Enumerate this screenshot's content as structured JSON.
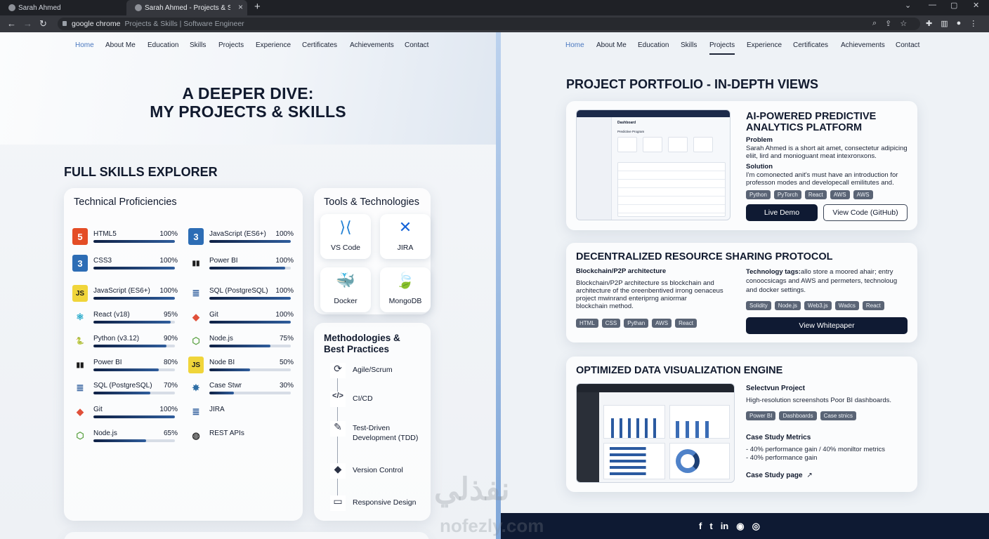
{
  "browser": {
    "tabs": [
      {
        "title": "Sarah Ahmed"
      },
      {
        "title": "Sarah Ahmed - Projects & Skills"
      }
    ],
    "new_tab": "+",
    "host": "google chrome",
    "path": "Projects & Skills | Software Engineer"
  },
  "left_nav": [
    "Home",
    "About Me",
    "Education",
    "Skills",
    "Projects",
    "Experience",
    "Certificates",
    "Achievements",
    "Contact"
  ],
  "right_nav": [
    "Home",
    "About Me",
    "Education",
    "Skills",
    "Projects",
    "Experience",
    "Certificates",
    "Achievements",
    "Contact"
  ],
  "hero": {
    "line1": "A DEEPER DIVE:",
    "line2": "MY PROJECTS & SKILLS"
  },
  "skills_section": "FULL SKILLS EXPLORER",
  "technical": {
    "title": "Technical Proficiencies",
    "left_col": [
      {
        "name": "HTML5",
        "pct": "100%",
        "level": 1.0,
        "icon": "html5-icon"
      },
      {
        "name": "CSS3",
        "pct": "100%",
        "level": 1.0,
        "icon": "css3-icon"
      },
      {
        "name": "JavaScript (ES6+)",
        "pct": "100%",
        "level": 1.0,
        "icon": "javascript-icon"
      },
      {
        "name": "React (v18)",
        "pct": "95%",
        "level": 0.95,
        "icon": "react-icon"
      },
      {
        "name": "Python (v3.12)",
        "pct": "90%",
        "level": 0.9,
        "icon": "python-icon"
      },
      {
        "name": "Power BI",
        "pct": "80%",
        "level": 0.8,
        "icon": "powerbi-icon"
      },
      {
        "name": "SQL (PostgreSQL)",
        "pct": "70%",
        "level": 0.7,
        "icon": "database-icon"
      },
      {
        "name": "Git",
        "pct": "100%",
        "level": 1.0,
        "icon": "git-icon"
      },
      {
        "name": "Node.js",
        "pct": "65%",
        "level": 0.65,
        "icon": "nodejs-icon"
      }
    ],
    "right_col": [
      {
        "name": "JavaScript (ES6+)",
        "pct": "100%",
        "level": 1.0,
        "icon": "css3-icon"
      },
      {
        "name": "Power BI",
        "pct": "100%",
        "level": 0.93,
        "icon": "powerbi-icon"
      },
      {
        "name": "SQL (PostgreSQL)",
        "pct": "100%",
        "level": 1.0,
        "icon": "database-icon"
      },
      {
        "name": "Git",
        "pct": "100%",
        "level": 1.0,
        "icon": "git-icon"
      },
      {
        "name": "Node.js",
        "pct": "75%",
        "level": 0.75,
        "icon": "nodejs-icon"
      },
      {
        "name": "Node BI",
        "pct": "50%",
        "level": 0.5,
        "icon": "javascript-icon"
      },
      {
        "name": "Case Stwr",
        "pct": "30%",
        "level": 0.3,
        "icon": "gear-icon"
      },
      {
        "name": "JIRA",
        "pct": "",
        "level": null,
        "icon": "database-icon"
      },
      {
        "name": "REST APIs",
        "pct": "",
        "level": null,
        "icon": "globe-icon"
      }
    ]
  },
  "tools": {
    "title": "Tools & Technologies",
    "items": [
      {
        "label": "VS Code",
        "icon": "vscode-icon"
      },
      {
        "label": "JIRA",
        "icon": "jira-icon"
      },
      {
        "label": "Docker",
        "icon": "docker-icon"
      },
      {
        "label": "MongoDB",
        "icon": "mongodb-icon"
      }
    ]
  },
  "methods": {
    "title_line1": "Methodologies &",
    "title_line2": "Best Practices",
    "items": [
      {
        "label": "Agile/Scrum",
        "icon": "cycle-icon"
      },
      {
        "label": "CI/CD",
        "icon": "code-icon"
      },
      {
        "label": "Test-Driven Development (TDD)",
        "icon": "edit-icon"
      },
      {
        "label": "Version Control",
        "icon": "git-icon"
      },
      {
        "label": "Responsive Design",
        "icon": "monitor-icon"
      }
    ]
  },
  "portfolio_title": "PROJECT PORTFOLIO - IN-DEPTH VIEWS",
  "p1": {
    "title_line1": "AI-POWERED PREDICTIVE",
    "title_line2": "ANALYTICS PLATFORM",
    "problem_label": "Problem",
    "problem_text_line1": "Sarah Ahmed is a short ait amet, consectetur adipicing",
    "problem_text_line2": "eliit, lird and monioguant meat intexronxons.",
    "solution_label": "Solution",
    "solution_text_line1": "I'm comonected anit's must have an introduction for",
    "solution_text_line2": "professon modes and developecall emilitutes and.",
    "tags": [
      "Python",
      "PyTorch",
      "React",
      "AWS",
      "AWS"
    ],
    "demo": "Live Demo",
    "code": "View Code (GitHub)",
    "mock_title": "Dashboard",
    "mock_sub": "Predictive Program"
  },
  "p2": {
    "title": "DECENTRALIZED RESOURCE SHARING PROTOCOL",
    "arch_label": "Blockchain/P2P architecture",
    "arch_text_1": "Blockchain/P2P architecture ss blockchain and",
    "arch_text_2": "architecture of the oreenbentived irrong oenaceus",
    "arch_text_3": "project mwinrand enteriprng aniormar",
    "arch_text_4": "blockchain method.",
    "tags_left": [
      "HTML",
      "CSS",
      "Pythan",
      "AWS",
      "React"
    ],
    "tech_label": "Technology tags:",
    "tech_text_1": "allo store a moored ahair; entry",
    "tech_text_2": "conoocsicags and AWS and permeters, technoloug",
    "tech_text_3": "and docker settings.",
    "tags_right": [
      "Solidity",
      "Node.js",
      "Web3.js",
      "Wadcs",
      "React"
    ],
    "button": "View Whitepaper"
  },
  "p3": {
    "title": "OPTIMIZED DATA VISUALIZATION ENGINE",
    "sel_label": "Selectvun Project",
    "sel_text": "High-resolution screenshots Poor BI dashboards.",
    "tags": [
      "Power BI",
      "Dashboards",
      "Case stnics"
    ],
    "metrics_label": "Case Study Metrics",
    "metric1": "- 40% performance gain / 40% moniltor metrics",
    "metric2": "- 40% performance gain",
    "link": "Case Study page"
  },
  "watermark": {
    "arabic": "نفذلي",
    "latin": "nofezly.com"
  },
  "colors": {
    "navy": "#0f1a33",
    "accent_blue": "#4a78c0",
    "tag_gray": "#5a6475"
  }
}
